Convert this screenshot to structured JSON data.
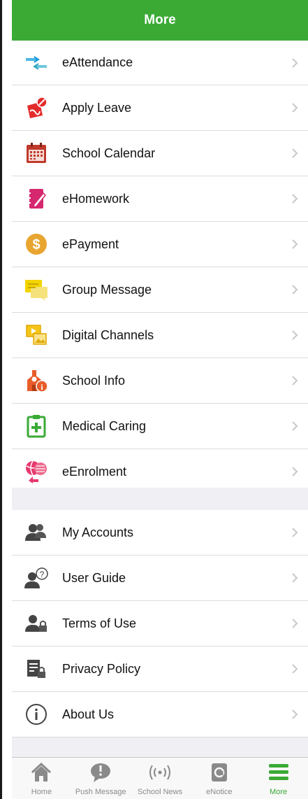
{
  "header": {
    "title": "More"
  },
  "menu": [
    {
      "label": "eAttendance",
      "icon": "attendance-arrows-icon"
    },
    {
      "label": "Apply Leave",
      "icon": "apply-leave-icon"
    },
    {
      "label": "School Calendar",
      "icon": "calendar-icon"
    },
    {
      "label": "eHomework",
      "icon": "homework-icon"
    },
    {
      "label": "ePayment",
      "icon": "dollar-coin-icon"
    },
    {
      "label": "Group Message",
      "icon": "group-message-icon"
    },
    {
      "label": "Digital Channels",
      "icon": "digital-channels-icon"
    },
    {
      "label": "School Info",
      "icon": "school-info-icon"
    },
    {
      "label": "Medical Caring",
      "icon": "medical-clipboard-icon"
    },
    {
      "label": "eEnrolment",
      "icon": "enrolment-sports-icon"
    }
  ],
  "settings": [
    {
      "label": "My Accounts",
      "icon": "accounts-icon"
    },
    {
      "label": "User Guide",
      "icon": "user-guide-icon"
    },
    {
      "label": "Terms of Use",
      "icon": "terms-lock-icon"
    },
    {
      "label": "Privacy Policy",
      "icon": "privacy-document-icon"
    },
    {
      "label": "About Us",
      "icon": "info-circle-icon"
    }
  ],
  "tabs": [
    {
      "label": "Home",
      "icon": "home-icon",
      "active": false
    },
    {
      "label": "Push Message",
      "icon": "push-message-icon",
      "active": false
    },
    {
      "label": "School News",
      "icon": "broadcast-icon",
      "active": false
    },
    {
      "label": "eNotice",
      "icon": "enotice-icon",
      "active": false
    },
    {
      "label": "More",
      "icon": "menu-bars-icon",
      "active": true
    }
  ],
  "colors": {
    "brand_green": "#3aaa35",
    "separator": "#dcdcdc",
    "group_bg": "#efeff4"
  }
}
